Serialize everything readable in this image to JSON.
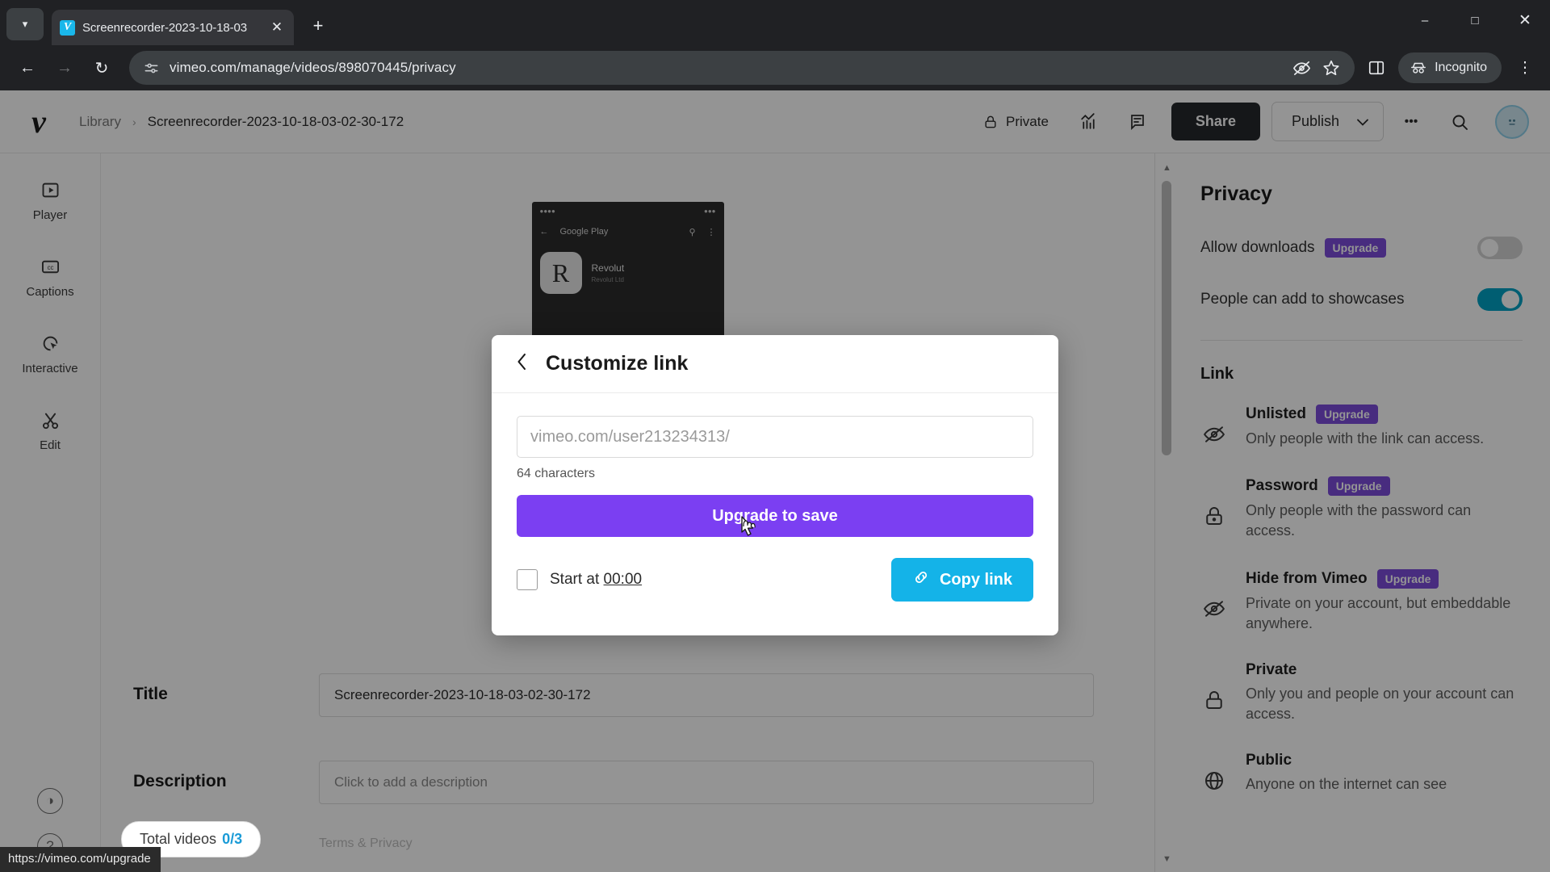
{
  "browser": {
    "tab": {
      "title": "Screenrecorder-2023-10-18-03",
      "favicon": "V",
      "close_icon": "close-icon"
    },
    "new_tab_label": "+",
    "window": {
      "minimize": "–",
      "maximize": "□",
      "close": "✕"
    },
    "toolbar": {
      "back": "←",
      "forward": "→",
      "reload": "↻",
      "site_info_icon": "site-settings-icon",
      "url": "vimeo.com/manage/videos/898070445/privacy",
      "tracking_icon": "eye-off-icon",
      "bookmark_icon": "star-icon",
      "side_panel_icon": "side-panel-icon",
      "incognito_label": "Incognito",
      "menu_icon": "three-dot-menu-icon"
    },
    "status_bar_url": "https://vimeo.com/upgrade"
  },
  "app": {
    "logo": "v",
    "breadcrumb": {
      "root": "Library",
      "separator": "›",
      "current": "Screenrecorder-2023-10-18-03-02-30-172"
    },
    "header_actions": {
      "privacy_label": "Private",
      "stats_icon": "analytics-icon",
      "comments_icon": "comment-icon",
      "share_label": "Share",
      "publish_label": "Publish",
      "publish_caret": "⌄",
      "more_label": "•••",
      "search_icon": "search-icon",
      "avatar": "avatar"
    },
    "rail": [
      {
        "label": "Player",
        "icon": "player-icon"
      },
      {
        "label": "Captions",
        "icon": "captions-icon"
      },
      {
        "label": "Interactive",
        "icon": "interactive-icon"
      },
      {
        "label": "Edit",
        "icon": "scissors-icon"
      }
    ],
    "rail_bottom": [
      {
        "icon": "contrast-icon",
        "glyph": "◑"
      },
      {
        "icon": "help-icon",
        "glyph": "?"
      }
    ],
    "video_preview": {
      "app_bar_title": "Google Play",
      "app_name": "Revolut",
      "app_developer": "Revolut Ltd",
      "app_icon_letter": "R",
      "back_arrow": "←",
      "search_icon": "search-icon",
      "overflow_icon": "⋮"
    },
    "meta": {
      "title_label": "Title",
      "title_value": "Screenrecorder-2023-10-18-03-02-30-172",
      "description_label": "Description",
      "description_placeholder": "Click to add a description"
    },
    "footer": {
      "total_videos_label": "Total videos",
      "total_videos_count": "0/3",
      "terms_label": "Terms & Privacy"
    }
  },
  "privacy_panel": {
    "title": "Privacy",
    "toggles": [
      {
        "label": "Allow downloads",
        "badge": "Upgrade",
        "on": false
      },
      {
        "label": "People can add to showcases",
        "badge": "",
        "on": true
      }
    ],
    "section_title": "Link",
    "options": [
      {
        "name": "Unlisted",
        "badge": "Upgrade",
        "desc": "Only people with the link can access.",
        "icon": "eye-off-icon"
      },
      {
        "name": "Password",
        "badge": "Upgrade",
        "desc": "Only people with the password can access.",
        "icon": "lock-icon"
      },
      {
        "name": "Hide from Vimeo",
        "badge": "Upgrade",
        "desc": "Private on your account, but embeddable anywhere.",
        "icon": "eye-off-icon"
      },
      {
        "name": "Private",
        "badge": "",
        "desc": "Only you and people on your account can access.",
        "icon": "lock-icon"
      },
      {
        "name": "Public",
        "badge": "",
        "desc": "Anyone on the internet can see",
        "icon": "globe-icon"
      }
    ]
  },
  "modal": {
    "back_icon": "chevron-left-icon",
    "title": "Customize link",
    "input_placeholder": "vimeo.com/user213234313/",
    "input_value": "",
    "char_count": "64 characters",
    "upgrade_label": "Upgrade to save",
    "start_at_label": "Start at",
    "start_at_time": "00:00",
    "start_at_checked": false,
    "copy_link_label": "Copy link",
    "copy_link_icon": "link-icon"
  },
  "colors": {
    "purple": "#7b3ff2",
    "badge_purple": "#7c4ddb",
    "cyan": "#14b3e8",
    "toggle_on": "#00a3c4",
    "dark": "#25292b"
  }
}
